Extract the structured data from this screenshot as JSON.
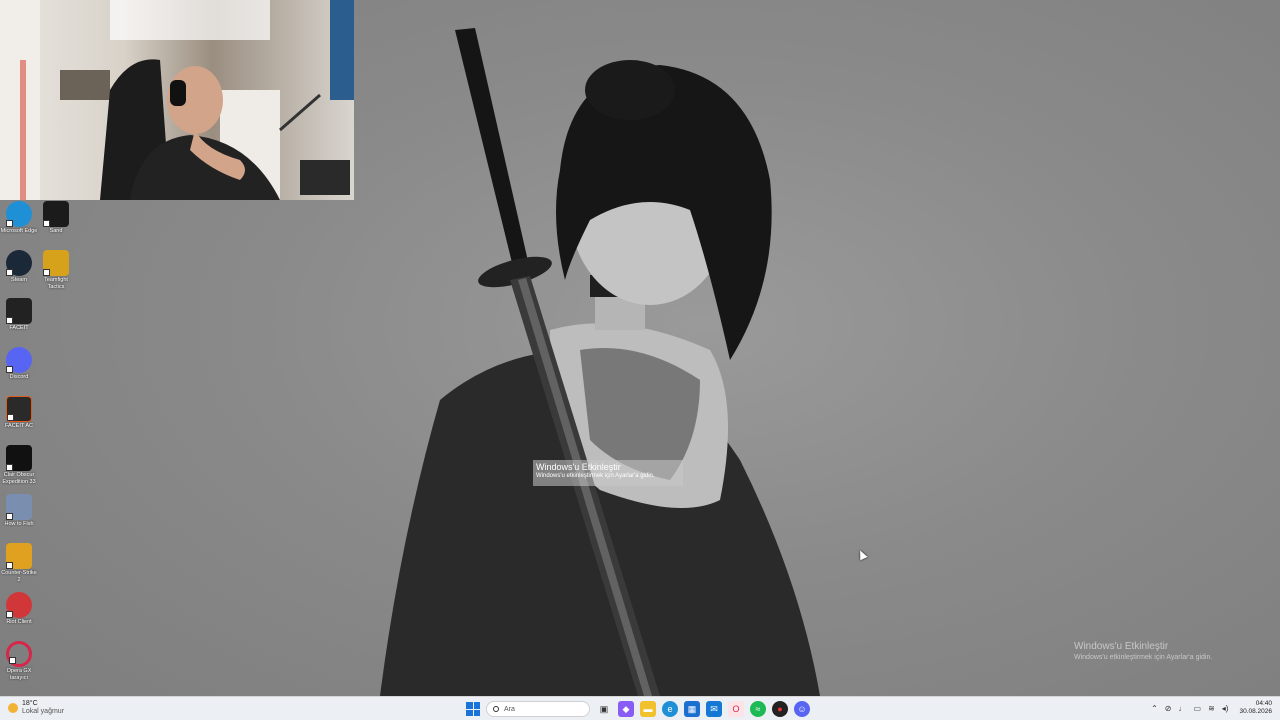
{
  "desktop": {
    "icons": [
      {
        "label": "Microsoft Edge",
        "icon": "edge-icon",
        "color": "#1f8fd6"
      },
      {
        "label": "Sand",
        "icon": "sand-game-icon",
        "color": "#1b1b1b"
      },
      {
        "label": "Steam",
        "icon": "steam-icon",
        "color": "#1b2838"
      },
      {
        "label": "Teamfight Tactics",
        "icon": "tft-icon",
        "color": "#d7a21b"
      },
      {
        "label": "FACEIT",
        "icon": "faceit-icon",
        "color": "#222222"
      },
      {
        "label": "Discord",
        "icon": "discord-icon",
        "color": "#5865f2"
      },
      {
        "label": "FACEIT AC",
        "icon": "faceit-ac-icon",
        "color": "#2a2a2a"
      },
      {
        "label": "Clair Obscur Expedition 33",
        "icon": "clair-obscur-icon",
        "color": "#111111"
      },
      {
        "label": "How to Fish",
        "icon": "how-to-fish-icon",
        "color": "#7a8fb0"
      },
      {
        "label": "Counter-Strike 2",
        "icon": "cs2-icon",
        "color": "#e0a020"
      },
      {
        "label": "Riot Client",
        "icon": "riot-icon",
        "color": "#d13639"
      },
      {
        "label": "Opera GX tarayıcı",
        "icon": "opera-gx-icon",
        "color": "#d8264b"
      }
    ]
  },
  "activation": {
    "title": "Windows'u Etkinleştir",
    "subtitle": "Windows'u etkinleştirmek için Ayarlar'a gidin.",
    "popup_title": "Windows'u Etkinleştir",
    "popup_subtitle": "Windows'u etkinleştirmek için Ayarlar'a gidin."
  },
  "taskbar": {
    "weather": {
      "temp": "18°C",
      "desc": "Lokal yağmur"
    },
    "search_placeholder": "Ara",
    "apps": [
      {
        "icon": "task-view-icon",
        "color": "#333333",
        "glyph": "▣"
      },
      {
        "icon": "copilot-icon",
        "color": "#8a5cf6",
        "glyph": "◆"
      },
      {
        "icon": "file-explorer-icon",
        "color": "#f2c12e",
        "glyph": "▬"
      },
      {
        "icon": "edge-icon",
        "color": "#1f8fd6",
        "glyph": "e"
      },
      {
        "icon": "store-icon",
        "color": "#1b6fd1",
        "glyph": "▦"
      },
      {
        "icon": "mail-icon",
        "color": "#1478d4",
        "glyph": "✉"
      },
      {
        "icon": "opera-gx-icon",
        "color": "#d8264b",
        "glyph": "O"
      },
      {
        "icon": "spotify-icon",
        "color": "#1db954",
        "glyph": "≈"
      },
      {
        "icon": "steam-helper-icon",
        "color": "#222222",
        "glyph": "●"
      },
      {
        "icon": "discord-icon",
        "color": "#5865f2",
        "glyph": "☺"
      }
    ],
    "clock_time": "04:40",
    "clock_date": "30.08.2026"
  }
}
